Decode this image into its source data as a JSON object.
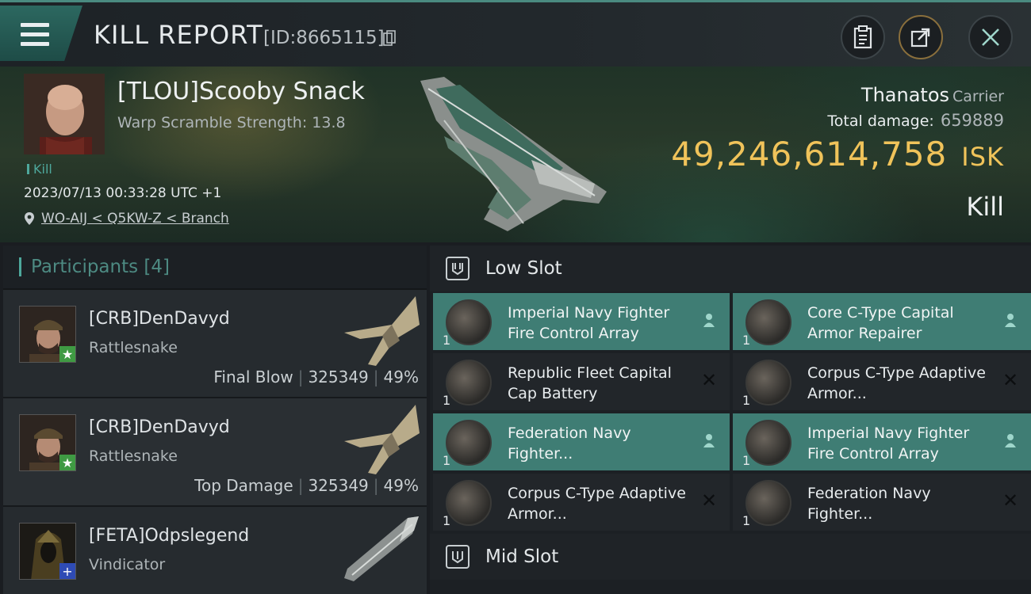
{
  "header": {
    "title": "KILL REPORT",
    "report_id": "[ID:8665115]"
  },
  "victim": {
    "name": "[TLOU]Scooby Snack",
    "scram": "Warp Scramble Strength: 13.8",
    "kill_tag": "Kill",
    "timestamp": "2023/07/13 00:33:28 UTC +1",
    "location": "WO-AIJ < Q5KW-Z < Branch",
    "ship": "Thanatos",
    "ship_class": "Carrier",
    "total_damage_label": "Total damage:",
    "total_damage": "659889",
    "isk_value": "49,246,614,758",
    "isk_unit": "ISK",
    "result": "Kill"
  },
  "participants": {
    "label": "Participants",
    "count": "[4]",
    "rows": [
      {
        "name": "[CRB]DenDavyd",
        "ship": "Rattlesnake",
        "role": "Final Blow",
        "damage": "325349",
        "percent": "49%",
        "badge": "★"
      },
      {
        "name": "[CRB]DenDavyd",
        "ship": "Rattlesnake",
        "role": "Top Damage",
        "damage": "325349",
        "percent": "49%",
        "badge": "★"
      },
      {
        "name": "[FETA]Odpslegend",
        "ship": "Vindicator",
        "role": "",
        "damage": "",
        "percent": "",
        "badge": "+"
      }
    ]
  },
  "fitting": {
    "low_slot_label": "Low Slot",
    "mid_slot_label": "Mid Slot",
    "low_slot": [
      {
        "name": "Imperial Navy Fighter Fire Control Array",
        "qty": "1",
        "status": "fitted"
      },
      {
        "name": "Core C-Type Capital Armor Repairer",
        "qty": "1",
        "status": "fitted"
      },
      {
        "name": "Republic Fleet Capital Cap Battery",
        "qty": "1",
        "status": "destroyed"
      },
      {
        "name": "Corpus C-Type Adaptive Armor...",
        "qty": "1",
        "status": "destroyed"
      },
      {
        "name": "Federation Navy Fighter...",
        "qty": "1",
        "status": "fitted"
      },
      {
        "name": "Imperial Navy Fighter Fire Control Array",
        "qty": "1",
        "status": "fitted"
      },
      {
        "name": "Corpus C-Type Adaptive Armor...",
        "qty": "1",
        "status": "destroyed"
      },
      {
        "name": "Federation Navy Fighter...",
        "qty": "1",
        "status": "destroyed"
      }
    ]
  },
  "icons": {
    "menu": "menu-icon",
    "clipboard": "clipboard-icon",
    "share": "share-icon",
    "close": "close-icon",
    "location": "location-pin-icon",
    "slot": "slot-icon",
    "fitted": "person-icon",
    "destroyed": "x-icon"
  },
  "colors": {
    "accent": "#4ea89c",
    "isk": "#f0c35a",
    "highlight_row": "#3f7d74"
  }
}
